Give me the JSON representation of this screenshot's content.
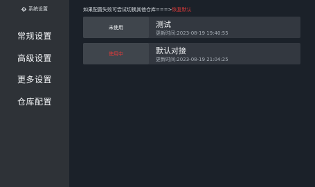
{
  "sidebar": {
    "header_label": "系统设置",
    "items": [
      {
        "label": "常规设置"
      },
      {
        "label": "高级设置"
      },
      {
        "label": "更多设置"
      },
      {
        "label": "仓库配置"
      }
    ]
  },
  "main": {
    "hint_text": "如果配置失败可尝试切换其他仓库===>",
    "restore_link": "恢复默认",
    "repos": [
      {
        "status": "未使用",
        "name": "测试",
        "updated": "更新时间:2023-08-19 19:40:55",
        "active": false
      },
      {
        "status": "使用中",
        "name": "默认对接",
        "updated": "更新时间:2023-08-19 21:04:25",
        "active": true
      }
    ]
  },
  "colors": {
    "sidebar_bg": "#2e3237",
    "main_bg": "#1b2129",
    "card_bg": "#333840",
    "badge_bg": "#3f454c",
    "accent_red": "#e03b3b"
  },
  "icons": {
    "header_icon": "gear-icon"
  }
}
